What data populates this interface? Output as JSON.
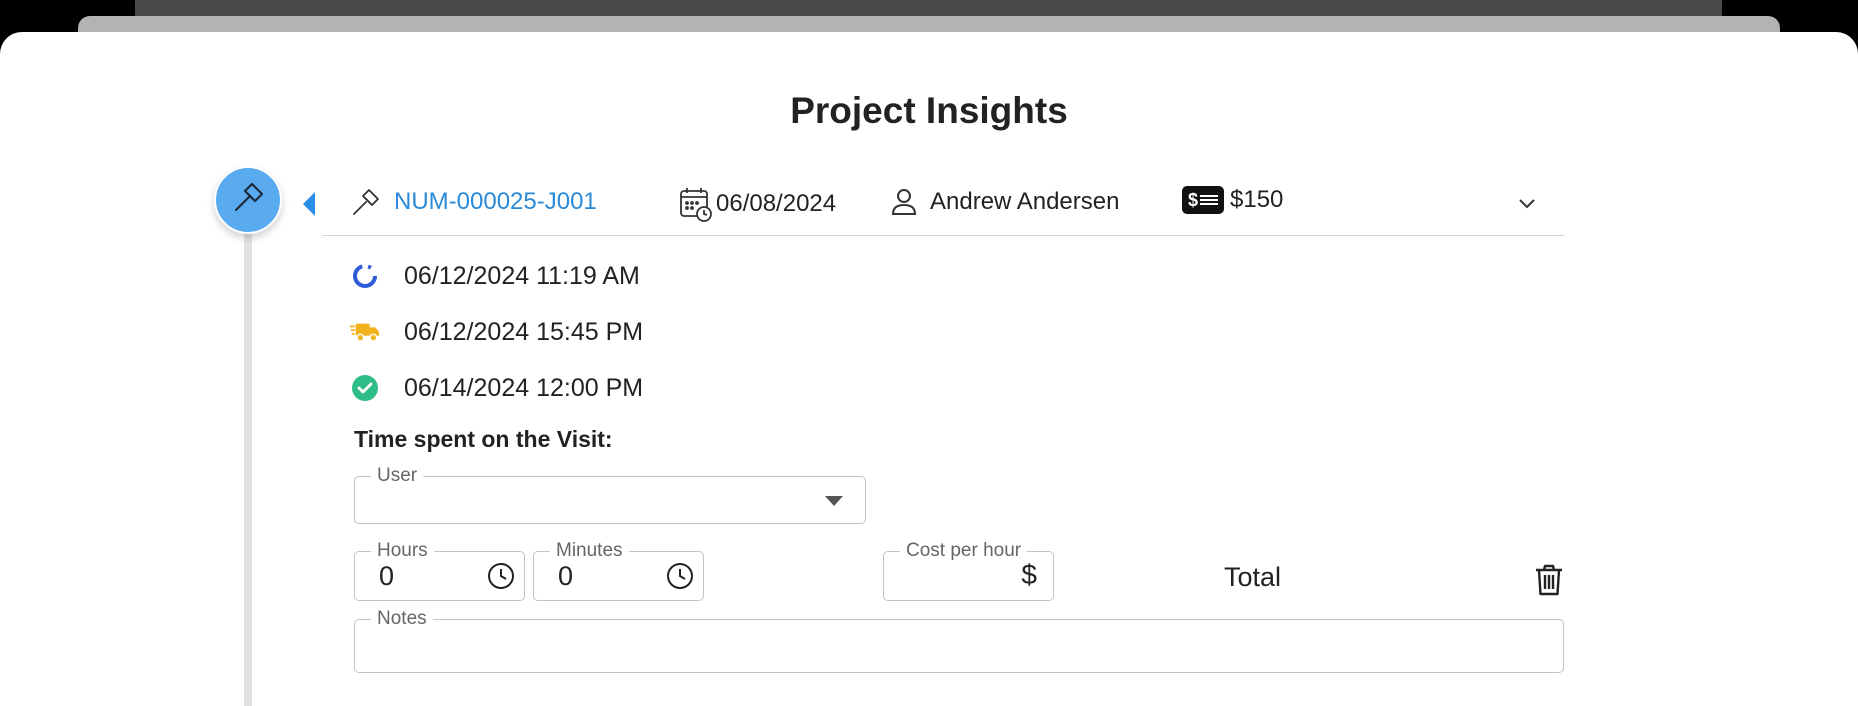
{
  "page": {
    "title": "Project Insights"
  },
  "header": {
    "job_number": "NUM-000025-J001",
    "date": "06/08/2024",
    "person": "Andrew Andersen",
    "cost_badge": "$",
    "cost": "$150"
  },
  "statuses": [
    {
      "icon": "progress-circle-icon",
      "text": "06/12/2024 11:19 AM",
      "color": "#2f5bd9"
    },
    {
      "icon": "delivery-truck-icon",
      "text": "06/12/2024 15:45 PM",
      "color": "#f1b21c"
    },
    {
      "icon": "check-circle-icon",
      "text": "06/14/2024 12:00 PM",
      "color": "#2ebd86"
    }
  ],
  "time_entry": {
    "section_title": "Time spent on the Visit:",
    "user_label": "User",
    "user_value": "",
    "hours_label": "Hours",
    "hours_value": "0",
    "minutes_label": "Minutes",
    "minutes_value": "0",
    "cost_label": "Cost per hour",
    "cost_symbol": "$",
    "total_label": "Total",
    "notes_label": "Notes",
    "notes_value": ""
  },
  "colors": {
    "accent": "#2b8ad8",
    "timeline_dot": "#5aaaf0"
  }
}
